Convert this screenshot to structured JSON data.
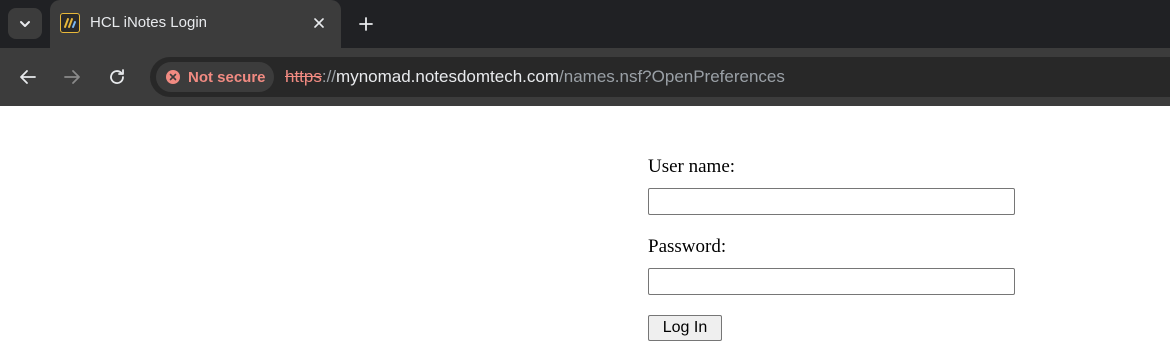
{
  "browser": {
    "tab": {
      "title": "HCL iNotes Login",
      "favicon": "hcl-notes-favicon-icon"
    },
    "toolbar": {
      "security_label": "Not secure",
      "url_scheme": "https",
      "url_separator": "://",
      "url_host": "mynomad.notesdomtech.com",
      "url_path": "/names.nsf?OpenPreferences"
    }
  },
  "login": {
    "username_label": "User name:",
    "username_value": "",
    "password_label": "Password:",
    "password_value": "",
    "submit_label": "Log In"
  },
  "colors": {
    "chrome_dark": "#202124",
    "chrome_tab": "#3c3c3c",
    "warning_red": "#f28b82",
    "favicon_accent": "#e8b83a"
  }
}
